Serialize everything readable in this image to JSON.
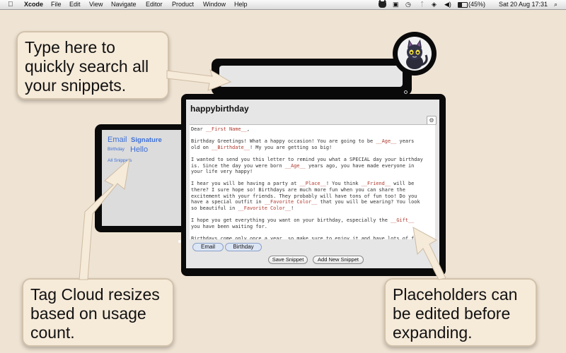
{
  "menubar": {
    "app": "Xcode",
    "menus": [
      "File",
      "Edit",
      "View",
      "Navigate",
      "Editor",
      "Product",
      "Window",
      "Help"
    ],
    "battery": "(45%)",
    "datetime": "Sat 20 Aug  17:31"
  },
  "callouts": {
    "search": [
      "Type here to",
      "quickly search all",
      "your snippets."
    ],
    "tags": [
      "Tag Cloud resizes",
      "based on usage",
      "count."
    ],
    "placeholders": [
      "Placeholders can",
      "be edited before",
      "expanding."
    ]
  },
  "tags": [
    "Email",
    "Signature",
    "Birthday",
    "Hello",
    "All Snippets"
  ],
  "snippet": {
    "title": "happybirthday",
    "gear": "⚙",
    "keywords": [
      "Email",
      "Birthday"
    ],
    "body": [
      [
        "Dear ",
        {
          "ph": "__First Name__"
        },
        ","
      ],
      [
        ""
      ],
      [
        "Birthday Greetings! What a happy occasion! You are going to be ",
        {
          "ph": "__Age__"
        },
        " years"
      ],
      [
        "old on ",
        {
          "ph": "__Birthdate__"
        },
        "! My you are getting so big!"
      ],
      [
        ""
      ],
      [
        "I wanted to send you this letter to remind you what a SPECIAL day your birthday"
      ],
      [
        "is. Since the day you were born ",
        {
          "ph": "__Age__"
        },
        " years ago, you have made everyone in"
      ],
      [
        "your life very happy!"
      ],
      [
        ""
      ],
      [
        "I hear you will be having a party at ",
        {
          "ph": "__Place__"
        },
        "! You think ",
        {
          "ph": "__Friend__"
        },
        " will be"
      ],
      [
        "there? I sure hope so! Birthdays are much more fun when you can share the"
      ],
      [
        "excitement with your friends. They probably will have tons of fun too! Do you"
      ],
      [
        "have a special outfit in ",
        {
          "ph": "__Favorite Color__"
        },
        " that you will be wearing? You look"
      ],
      [
        "so beautiful in ",
        {
          "ph": "__Favorite Color__"
        },
        "!"
      ],
      [
        ""
      ],
      [
        "I hope you get everything you want on your birthday, especially the ",
        {
          "ph": "__Gift__"
        }
      ],
      [
        "you have been waiting for."
      ],
      [
        ""
      ],
      [
        "Birthdays come only once a year, so make sure to enjoy it and have lots of fun!"
      ]
    ],
    "save_label": "Save Snippet",
    "add_label": "Add New Snippet"
  },
  "colors": {
    "placeholder": "#b03a2e",
    "tag": "#3d6fd6",
    "background": "#efe3d3"
  }
}
